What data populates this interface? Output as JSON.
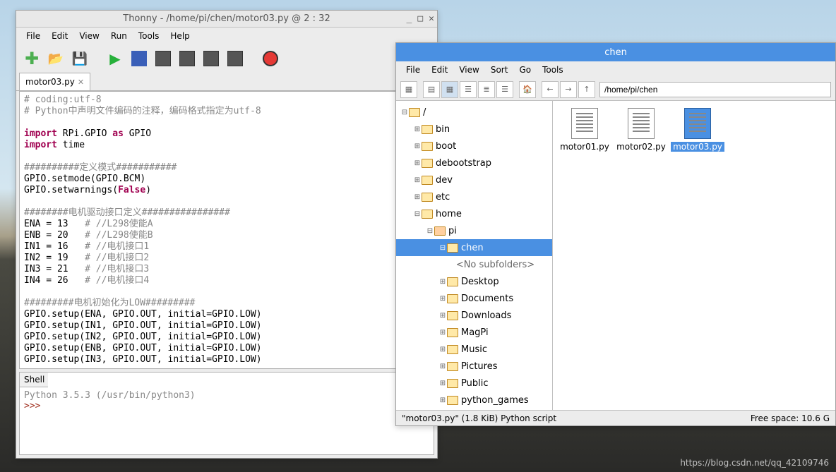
{
  "thonny": {
    "title": "Thonny  -  /home/pi/chen/motor03.py  @  2 : 32",
    "menu": [
      "File",
      "Edit",
      "View",
      "Run",
      "Tools",
      "Help"
    ],
    "tab": {
      "name": "motor03.py"
    },
    "code": {
      "l1": "# coding:utf-8",
      "l2": "# Python中声明文件编码的注释，编码格式指定为utf-8",
      "l3a": "import",
      "l3b": " RPi.GPIO ",
      "l3c": "as",
      "l3d": " GPIO",
      "l4a": "import",
      "l4b": " time",
      "l5": "##########定义模式###########",
      "l6": "GPIO.setmode(GPIO.BCM)",
      "l7a": "GPIO.setwarnings(",
      "l7b": "False",
      "l7c": ")",
      "l8": "########电机驱动接口定义################",
      "l9a": "ENA = ",
      "l9b": "13",
      "l9c": "   # //L298使能A",
      "l10a": "ENB = ",
      "l10b": "20",
      "l10c": "   # //L298使能B",
      "l11a": "IN1 = ",
      "l11b": "16",
      "l11c": "   # //电机接口1",
      "l12a": "IN2 = ",
      "l12b": "19",
      "l12c": "   # //电机接口2",
      "l13a": "IN3 = ",
      "l13b": "21",
      "l13c": "   # //电机接口3",
      "l14a": "IN4 = ",
      "l14b": "26",
      "l14c": "   # //电机接口4",
      "l15": "#########电机初始化为LOW#########",
      "l16": "GPIO.setup(ENA, GPIO.OUT, initial=GPIO.LOW)",
      "l17": "GPIO.setup(IN1, GPIO.OUT, initial=GPIO.LOW)",
      "l18": "GPIO.setup(IN2, GPIO.OUT, initial=GPIO.LOW)",
      "l19": "GPIO.setup(ENB, GPIO.OUT, initial=GPIO.LOW)",
      "l20": "GPIO.setup(IN3, GPIO.OUT, initial=GPIO.LOW)"
    },
    "shell": {
      "label": "Shell",
      "version": "Python 3.5.3 (/usr/bin/python3)",
      "prompt": ">>> "
    }
  },
  "fileman": {
    "title": "chen",
    "menu": [
      "File",
      "Edit",
      "View",
      "Sort",
      "Go",
      "Tools"
    ],
    "path": "/home/pi/chen",
    "tree": [
      {
        "label": "/",
        "indent": 0,
        "exp": "–",
        "open": true
      },
      {
        "label": "bin",
        "indent": 1,
        "exp": "+"
      },
      {
        "label": "boot",
        "indent": 1,
        "exp": "+"
      },
      {
        "label": "debootstrap",
        "indent": 1,
        "exp": "+"
      },
      {
        "label": "dev",
        "indent": 1,
        "exp": "+"
      },
      {
        "label": "etc",
        "indent": 1,
        "exp": "+"
      },
      {
        "label": "home",
        "indent": 1,
        "exp": "–",
        "open": true
      },
      {
        "label": "pi",
        "indent": 2,
        "exp": "–",
        "open": true,
        "home": true
      },
      {
        "label": "chen",
        "indent": 3,
        "exp": "–",
        "open": true,
        "selected": true
      },
      {
        "label": "<No subfolders>",
        "indent": 3,
        "nosub": true
      },
      {
        "label": "Desktop",
        "indent": 3,
        "exp": "+"
      },
      {
        "label": "Documents",
        "indent": 3,
        "exp": "+"
      },
      {
        "label": "Downloads",
        "indent": 3,
        "exp": "+"
      },
      {
        "label": "MagPi",
        "indent": 3,
        "exp": "+"
      },
      {
        "label": "Music",
        "indent": 3,
        "exp": "+"
      },
      {
        "label": "Pictures",
        "indent": 3,
        "exp": "+"
      },
      {
        "label": "Public",
        "indent": 3,
        "exp": "+"
      },
      {
        "label": "python_games",
        "indent": 3,
        "exp": "+"
      }
    ],
    "files": [
      {
        "name": "motor01.py",
        "selected": false
      },
      {
        "name": "motor02.py",
        "selected": false
      },
      {
        "name": "motor03.py",
        "selected": true
      }
    ],
    "status_left": "\"motor03.py\" (1.8 KiB) Python script",
    "status_right": "Free space: 10.6 G"
  },
  "watermark": "https://blog.csdn.net/qq_42109746"
}
